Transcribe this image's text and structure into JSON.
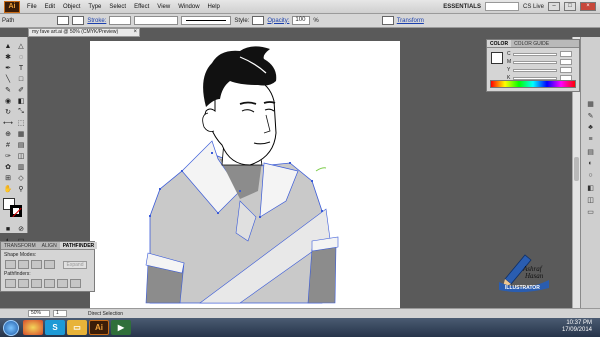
{
  "menubar": {
    "app_logo": "Ai",
    "items": [
      "File",
      "Edit",
      "Object",
      "Type",
      "Select",
      "Effect",
      "View",
      "Window",
      "Help"
    ],
    "workspace": "ESSENTIALS",
    "cs_live": "CS Live"
  },
  "controlbar": {
    "selection": "Path",
    "stroke_label": "Stroke:",
    "style_label": "Style:",
    "opacity_label": "Opacity:",
    "opacity_value": "100",
    "opacity_unit": "%",
    "transform_label": "Transform"
  },
  "document": {
    "tab_title": "my fave art.ai @ 50% (CMYK/Preview)",
    "close": "×"
  },
  "color_panel": {
    "tabs": [
      "COLOR",
      "COLOR GUIDE"
    ],
    "sliders": [
      "C",
      "M",
      "Y",
      "K"
    ]
  },
  "pathfinder_panel": {
    "tabs": [
      "TRANSFORM",
      "ALIGN",
      "PATHFINDER"
    ],
    "shape_modes_label": "Shape Modes:",
    "pathfinders_label": "Pathfinders:",
    "expand_label": "Expand"
  },
  "statusbar": {
    "zoom": "50%",
    "page": "1",
    "tool": "Direct Selection"
  },
  "taskbar": {
    "time": "10:37 PM",
    "date": "17/09/2014"
  },
  "watermark": {
    "line1": "Ashraf",
    "line2": "Hasan",
    "line3": "ILLUSTRATOR"
  },
  "colors": {
    "accent_selection": "#3a5bd9",
    "artwork_gray": "#c9c9c9",
    "artwork_dark": "#8c8c8c"
  }
}
